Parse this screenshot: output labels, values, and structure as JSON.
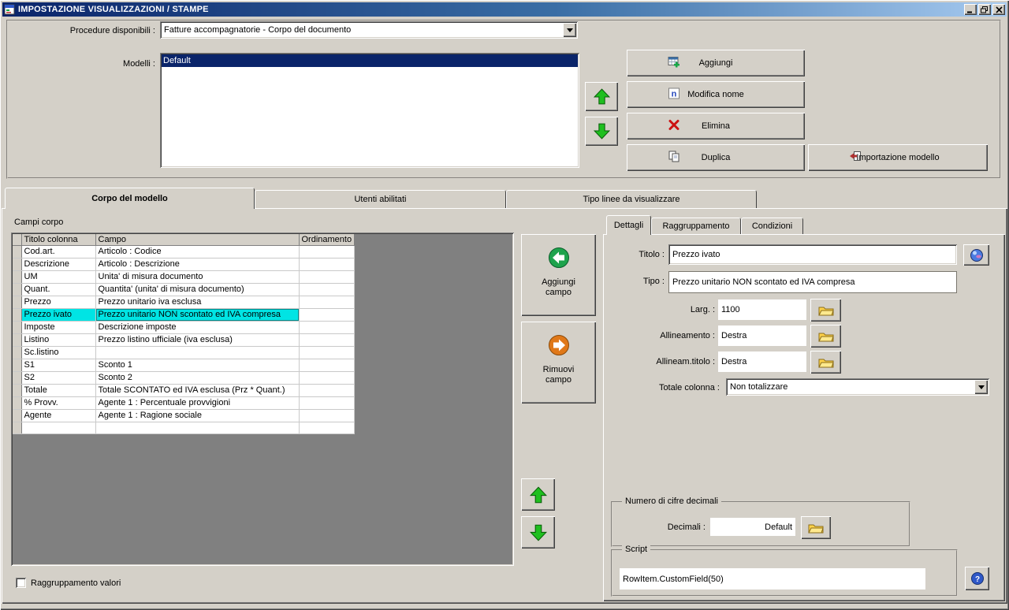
{
  "window": {
    "title": "IMPOSTAZIONE VISUALIZZAZIONI / STAMPE"
  },
  "colors": {
    "titlebar_start": "#0a246a",
    "titlebar_end": "#a6caf0",
    "list_selection": "#0a246a",
    "grid_selection": "#00e4e4",
    "window_face": "#d4d0c8",
    "grid_backdrop": "#808080"
  },
  "top": {
    "procedure_label": "Procedure disponibili :",
    "procedure_value": "Fatture accompagnatorie - Corpo del documento",
    "modelli_label": "Modelli :",
    "modelli_items": [
      "Default"
    ],
    "modelli_selected": 0,
    "buttons": {
      "aggiungi": "Aggiungi",
      "modifica_nome": "Modifica nome",
      "elimina": "Elimina",
      "duplica": "Duplica",
      "importazione": "Importazione modello"
    }
  },
  "tabs": [
    "Corpo del modello",
    "Utenti abilitati",
    "Tipo linee da visualizzare"
  ],
  "body": {
    "campi_corpo_label": "Campi corpo",
    "grid": {
      "columns": [
        "Titolo colonna",
        "Campo",
        "Ordinamento"
      ],
      "rows": [
        [
          "Cod.art.",
          "Articolo : Codice",
          ""
        ],
        [
          "Descrizione",
          "Articolo : Descrizione",
          ""
        ],
        [
          "UM",
          "Unita' di misura documento",
          ""
        ],
        [
          "Quant.",
          "Quantita' (unita' di misura documento)",
          ""
        ],
        [
          "Prezzo",
          "Prezzo unitario iva esclusa",
          ""
        ],
        [
          "Prezzo ivato",
          "Prezzo unitario NON scontato ed IVA compresa",
          ""
        ],
        [
          "Imposte",
          "Descrizione imposte",
          ""
        ],
        [
          "Listino",
          "Prezzo listino ufficiale (iva esclusa)",
          ""
        ],
        [
          "Sc.listino",
          "",
          ""
        ],
        [
          "S1",
          "Sconto 1",
          ""
        ],
        [
          "S2",
          "Sconto 2",
          ""
        ],
        [
          "Totale",
          "Totale SCONTATO ed IVA esclusa (Prz * Quant.)",
          ""
        ],
        [
          "% Provv.",
          "Agente 1 : Percentuale provvigioni",
          ""
        ],
        [
          "Agente",
          "Agente 1 : Ragione sociale",
          ""
        ]
      ],
      "selected_row": 5
    },
    "aggiungi_campo": "Aggiungi campo",
    "rimuovi_campo": "Rimuovi campo",
    "raggruppamento_valori": "Raggruppamento valori"
  },
  "details": {
    "tabs": [
      "Dettagli",
      "Raggruppamento",
      "Condizioni"
    ],
    "titolo_label": "Titolo :",
    "titolo_value": "Prezzo ivato",
    "tipo_label": "Tipo :",
    "tipo_value": "Prezzo unitario NON scontato ed IVA compresa",
    "larg_label": "Larg. :",
    "larg_value": "1100",
    "allineamento_label": "Allineamento :",
    "allineamento_value": "Destra",
    "allineam_titolo_label": "Allineam.titolo :",
    "allineam_titolo_value": "Destra",
    "totale_colonna_label": "Totale colonna :",
    "totale_colonna_value": "Non totalizzare",
    "decimali_group": "Numero di cifre decimali",
    "decimali_label": "Decimali :",
    "decimali_value": "Default",
    "script_group": "Script",
    "script_value": "RowItem.CustomField(50)"
  }
}
